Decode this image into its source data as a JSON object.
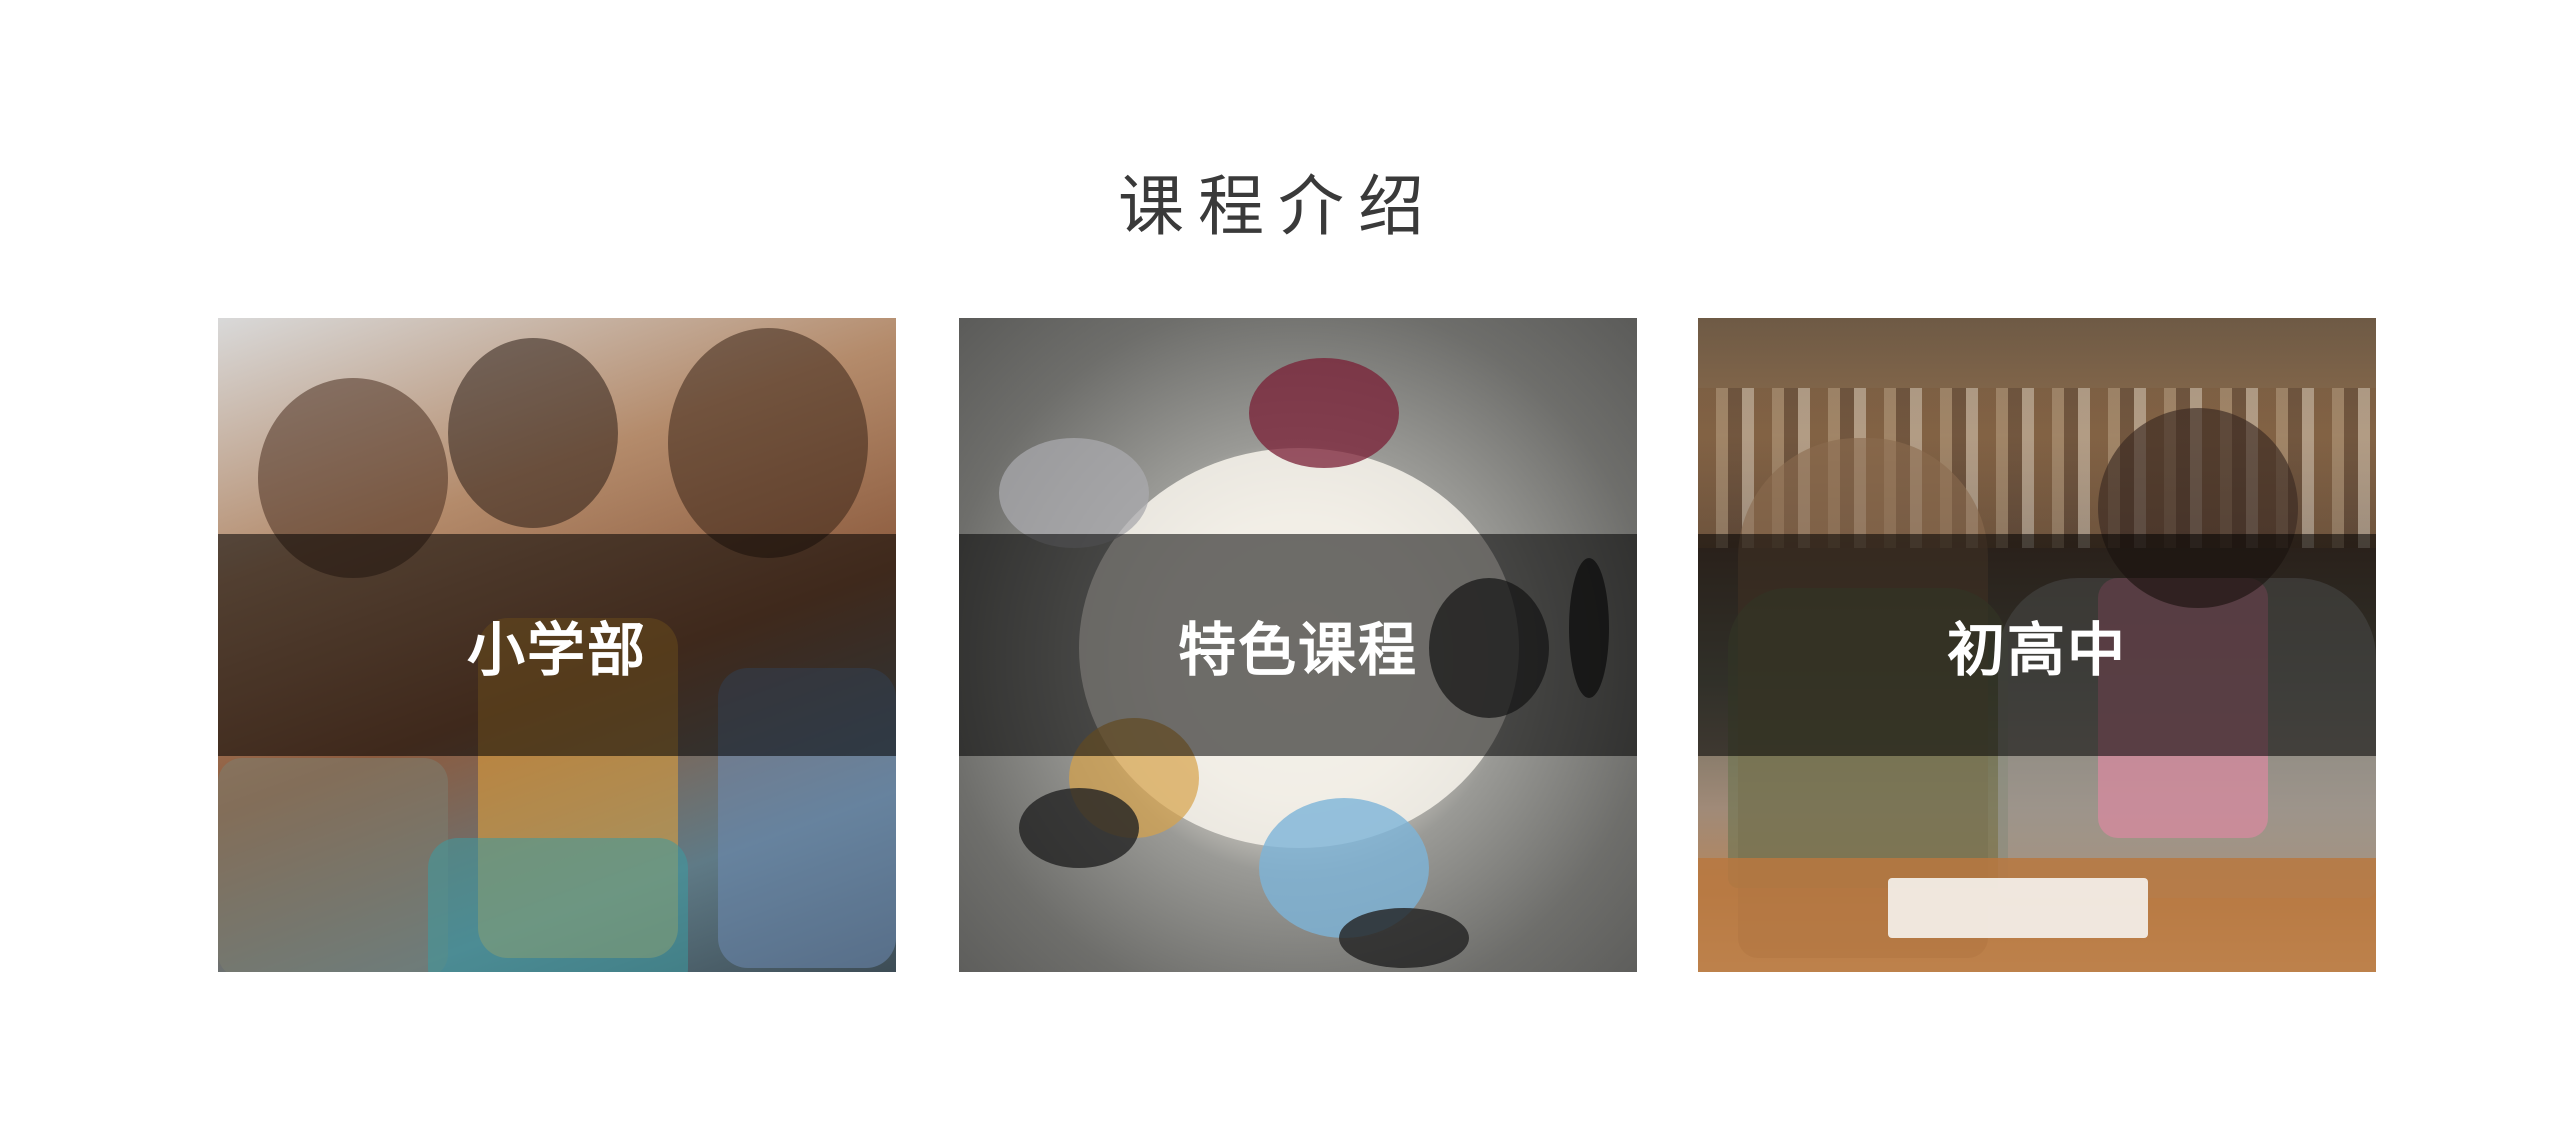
{
  "section": {
    "title": "课程介绍"
  },
  "cards": [
    {
      "label": "小学部",
      "image": "students-group-photo"
    },
    {
      "label": "特色课程",
      "image": "study-table-overhead-photo"
    },
    {
      "label": "初高中",
      "image": "library-students-photo"
    }
  ]
}
